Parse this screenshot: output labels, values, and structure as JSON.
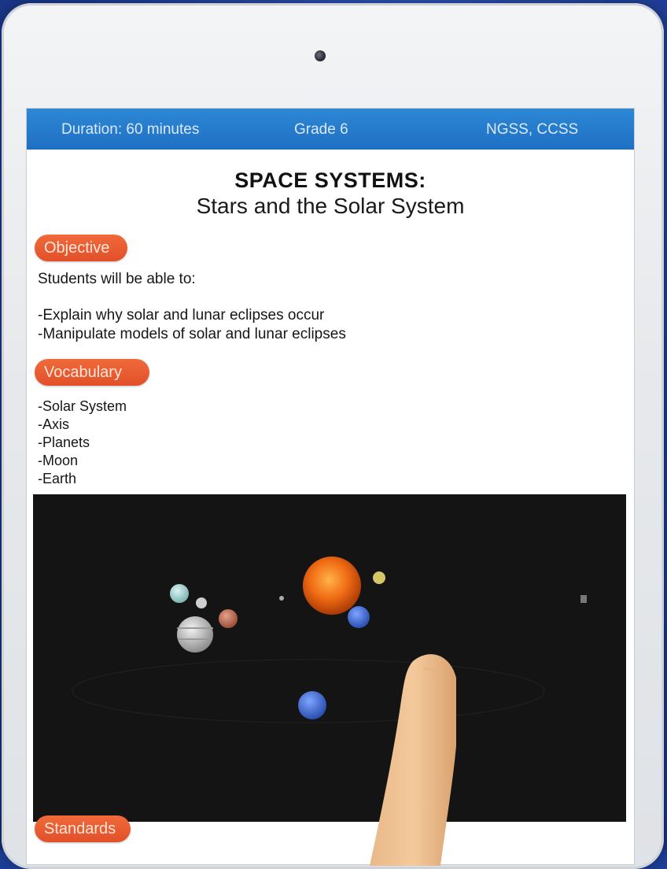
{
  "header": {
    "duration": "Duration: 60 minutes",
    "grade": "Grade 6",
    "standards": "NGSS, CCSS"
  },
  "lesson": {
    "title": "SPACE SYSTEMS:",
    "subtitle": "Stars and the Solar System"
  },
  "objective": {
    "label": "Objective",
    "intro": "Students will be able to:",
    "items": [
      "-Explain why solar and lunar eclipses occur",
      "-Manipulate models of solar and lunar eclipses"
    ]
  },
  "vocabulary": {
    "label": "Vocabulary",
    "items": [
      "-Solar System",
      "-Axis",
      "-Planets",
      "-Moon",
      "-Earth"
    ]
  },
  "media": {
    "description_icon": "solar-system-visual"
  },
  "standards": {
    "label": "Standards"
  },
  "colors": {
    "header_blue": "#1f6fc2",
    "pill_orange": "#e2502a",
    "media_bg": "#141414"
  }
}
